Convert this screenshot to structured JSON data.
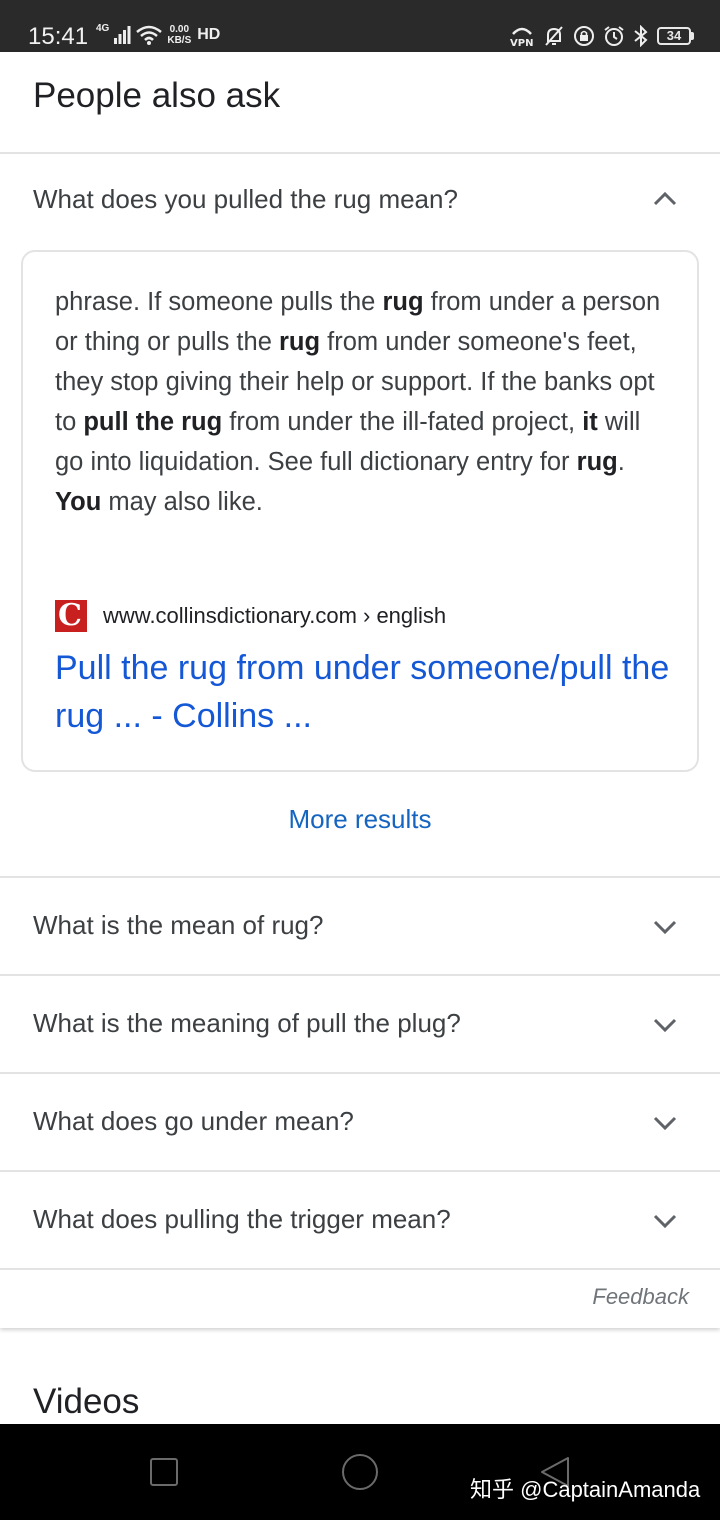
{
  "status_bar": {
    "time": "15:41",
    "network": "4G",
    "speed_value": "0.00",
    "speed_unit": "KB/S",
    "hd": "HD",
    "battery": "34"
  },
  "paa": {
    "title": "People also ask",
    "expanded_question": "What does you pulled the rug mean?",
    "answer": {
      "source_url": "www.collinsdictionary.com › english",
      "favicon_letter": "C",
      "link_title": "Pull the rug from under someone/pull the rug ... - Collins ..."
    },
    "more_results": "More results",
    "questions": [
      "What is the mean of rug?",
      "What is the meaning of pull the plug?",
      "What does go under mean?",
      "What does pulling the trigger mean?"
    ],
    "feedback": "Feedback"
  },
  "videos": {
    "title": "Videos"
  },
  "watermark": "知乎 @CaptainAmanda"
}
